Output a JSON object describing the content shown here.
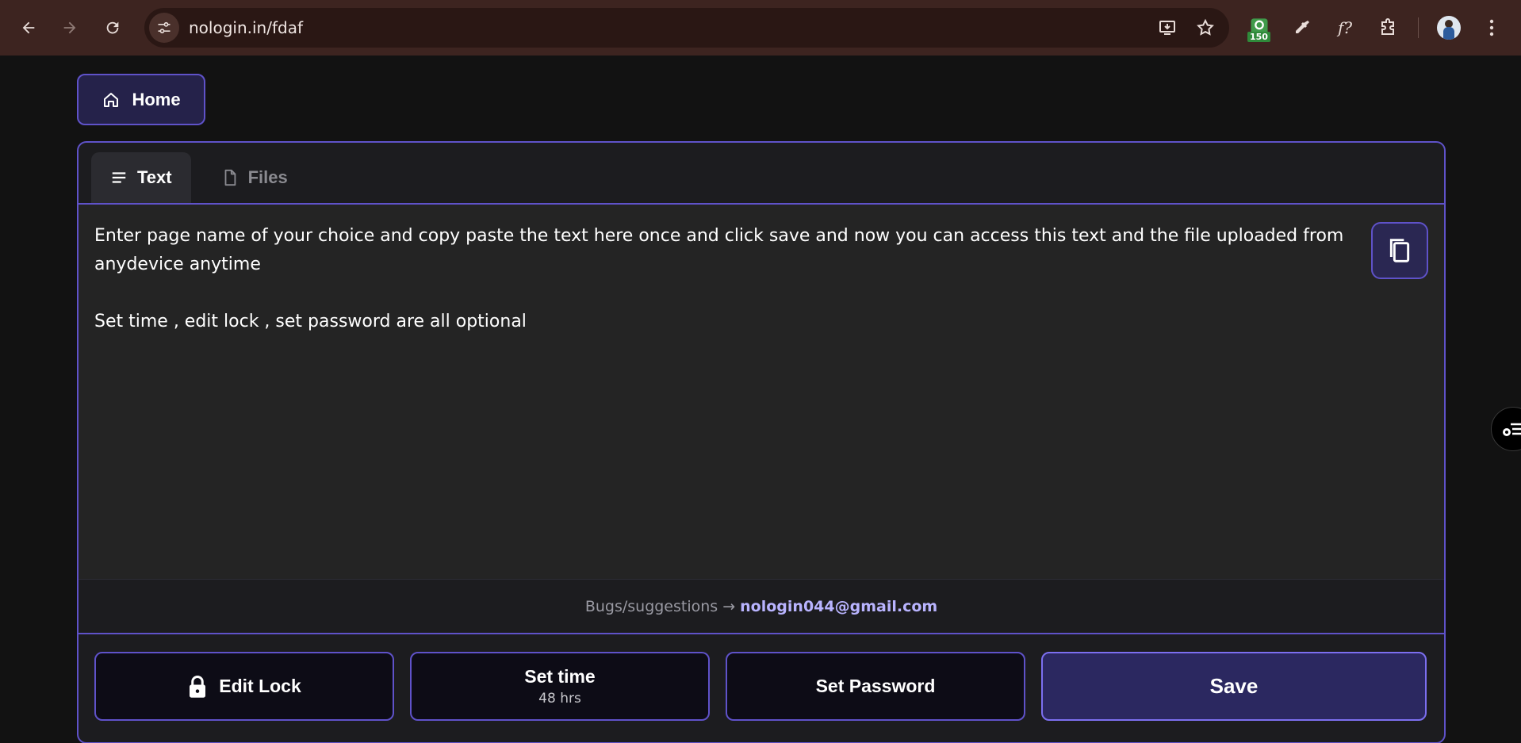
{
  "browser": {
    "url": "nologin.in/fdaf",
    "extension_badge": "150"
  },
  "nav": {
    "home_label": "Home"
  },
  "tabs": [
    {
      "label": "Text",
      "active": true
    },
    {
      "label": "Files",
      "active": false
    }
  ],
  "editor": {
    "line1": "Enter page name of your choice and copy paste the text here once and click save and now you can access this text and the file uploaded from anydevice anytime",
    "line2": "Set time , edit lock , set password are all optional"
  },
  "footer": {
    "prefix": "Bugs/suggestions →",
    "email": "nologin044@gmail.com"
  },
  "actions": {
    "edit_lock": "Edit Lock",
    "set_time": "Set time",
    "set_time_value": "48 hrs",
    "set_password": "Set Password",
    "save": "Save"
  },
  "colors": {
    "accent": "#5f52c9",
    "chrome": "#3d2420",
    "page_bg": "#121212"
  }
}
